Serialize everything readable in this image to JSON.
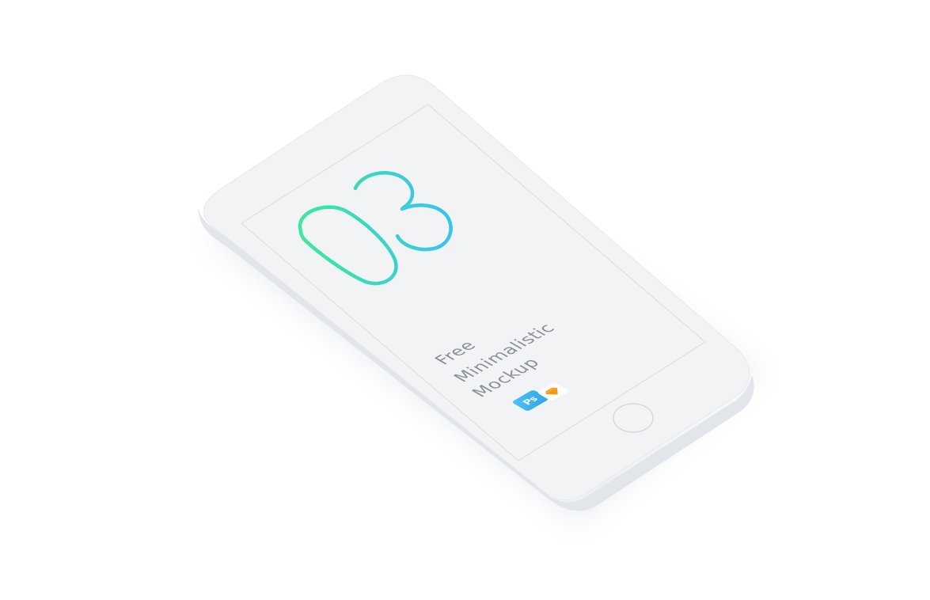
{
  "mockup": {
    "number": "03",
    "title_lines": [
      "Free",
      "Minimalistic",
      "Mockup"
    ],
    "badges": {
      "photoshop_label": "Ps",
      "photoshop_icon": "photoshop-icon",
      "sketch_icon": "sketch-diamond-icon"
    }
  },
  "colors": {
    "background": "#ffffff",
    "device_body": "#f2f3f5",
    "device_edge": "#e2e5ea",
    "screen_outline": "#d8dce1",
    "text": "#8a9098",
    "gradient_start": "#3ee89a",
    "gradient_end": "#38c4ee",
    "photoshop_blue": "#2fa5e8",
    "sketch_orange": "#f6a623"
  }
}
